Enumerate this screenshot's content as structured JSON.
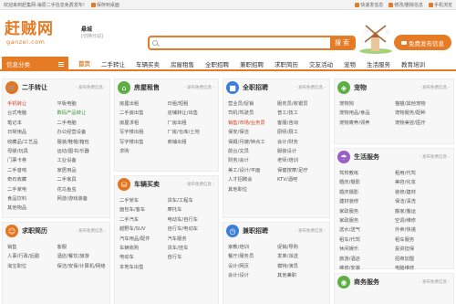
{
  "topbar": {
    "welcome": "欢迎来到赶集网-海原二手信息免费发布！",
    "save_desktop": "保存到桌面",
    "fast_post": "快速发信息",
    "manage": "修改/删除信息",
    "mobile": "手机浏览"
  },
  "header": {
    "logo_cn": "赶贼网",
    "logo_en": "ganzei.com",
    "city": "悬城",
    "city_switch": "[切换分站]",
    "search_placeholder": "",
    "search_btn": "搜 索",
    "post_btn": "免费发布信息"
  },
  "nav": {
    "category_label": "信息分类",
    "items": [
      "首页",
      "二手转让",
      "车辆买卖",
      "房屋租售",
      "全职招聘",
      "兼职招聘",
      "求职简历",
      "交友活动",
      "宠物",
      "生活服务",
      "教育培训"
    ]
  },
  "post_label": "- 发布免费信息 -",
  "panels": {
    "ershou": {
      "title": "二手转让",
      "icon": "cart-icon",
      "links": [
        "手机转让",
        "平板电脑",
        "台式电脑",
        "数码产品转让",
        "笔记本",
        "二手电脑",
        "日常用品",
        "办公经营设备",
        "收藏品/工艺品",
        "服装/鞋帽/箱包",
        "母婴/玩具",
        "运动/图书/乐器",
        "门票卡券",
        "工业设备",
        "二手音响",
        "家居用品",
        "奇石收藏",
        "二手家具",
        "二手家电",
        "花鸟鱼虫",
        "食品饮料",
        "网游/游戏装备",
        "其他物品"
      ]
    },
    "qiuzhi": {
      "title": "求职简历",
      "icon": "person-icon",
      "links": [
        "销售",
        "客服",
        "人事/行政/后勤",
        "酒店/餐饮/旅游",
        "淘宝职位",
        "保洁/安保/计算机/网络"
      ]
    },
    "fangwu": {
      "title": "房屋租售",
      "icon": "house-icon",
      "links": [
        "房屋出租",
        "日租/短租",
        "二手房出售",
        "店铺转让/出售",
        "房屋求租",
        "厂房出租",
        "写字楼出租",
        "厂房/仓库/土地",
        "写字楼出售",
        "商铺出租",
        "求购"
      ]
    },
    "cheliang": {
      "title": "车辆买卖",
      "icon": "car-icon",
      "links": [
        "二手轿车",
        "货车/工程车",
        "面包车/客车",
        "摩托车",
        "二手汽车",
        "电动车/自行车",
        "越野车/SUV",
        "自行车/电动车",
        "汽车用品/配件",
        "汽车服务",
        "车辆收购",
        "货车/挂车",
        "电动车",
        "自行车",
        "本地车出售"
      ]
    },
    "quanzhi": {
      "title": "全职招聘",
      "icon": "briefcase-icon",
      "links": [
        "营业员/促销",
        "服务员/收银员",
        "司机/驾驶员",
        "普工/技工",
        "销售/市场/业务员",
        "客服/咨询",
        "保安/保洁",
        "厨师/厨工",
        "保姆/月嫂/钟点工",
        "会计/财务",
        "前台/文员",
        "服装设计",
        "财务/会计",
        "老师/培训",
        "美工/设计/平面",
        "保健按摩/足疗",
        "人才招聘会",
        "KTV/酒吧",
        "其他职位"
      ]
    },
    "jianzhi": {
      "title": "兼职招聘",
      "icon": "clock-icon",
      "links": [
        "家教/培训",
        "促销/导购",
        "餐厅/服务员",
        "发单/派送",
        "设计/网页",
        "模特/演员",
        "会计/设计",
        "其他兼职"
      ]
    },
    "chongwu": {
      "title": "宠物",
      "icon": "dog-icon",
      "links": [
        "宠物狗",
        "猫猫/其他宠物",
        "宠物用品/食品",
        "宠物服务/配种",
        "宠物寄养/领养",
        "宠物美容/医疗"
      ]
    },
    "shenghuo": {
      "title": "生活服务",
      "icon": "umbrella-icon",
      "links": [
        "驾校教练",
        "租用/代驾",
        "婚庆/摄影",
        "美容/化妆",
        "婚庆摄影",
        "装修/建材",
        "建材装修",
        "保洁/清洗",
        "家政服务",
        "搬家/搬运",
        "家政服务",
        "空调/维修",
        "送水/送气",
        "外卖/快递",
        "租车/代驾",
        "租车服务",
        "休闲娱乐",
        "投资担保",
        "旅游/酒店",
        "招商加盟",
        "维修/安装",
        "电脑维修",
        "家电维修",
        "其他服务"
      ]
    },
    "shangwu": {
      "title": "商务服务",
      "icon": "handshake-icon",
      "links": []
    }
  },
  "colors": {
    "accent": "#e57b24",
    "orange_icon": "#e5741d",
    "green_icon": "#5cae45",
    "blue_icon": "#3d7fd6",
    "purple_icon": "#9b5fc5",
    "highlight_red": "#d43a1e"
  }
}
